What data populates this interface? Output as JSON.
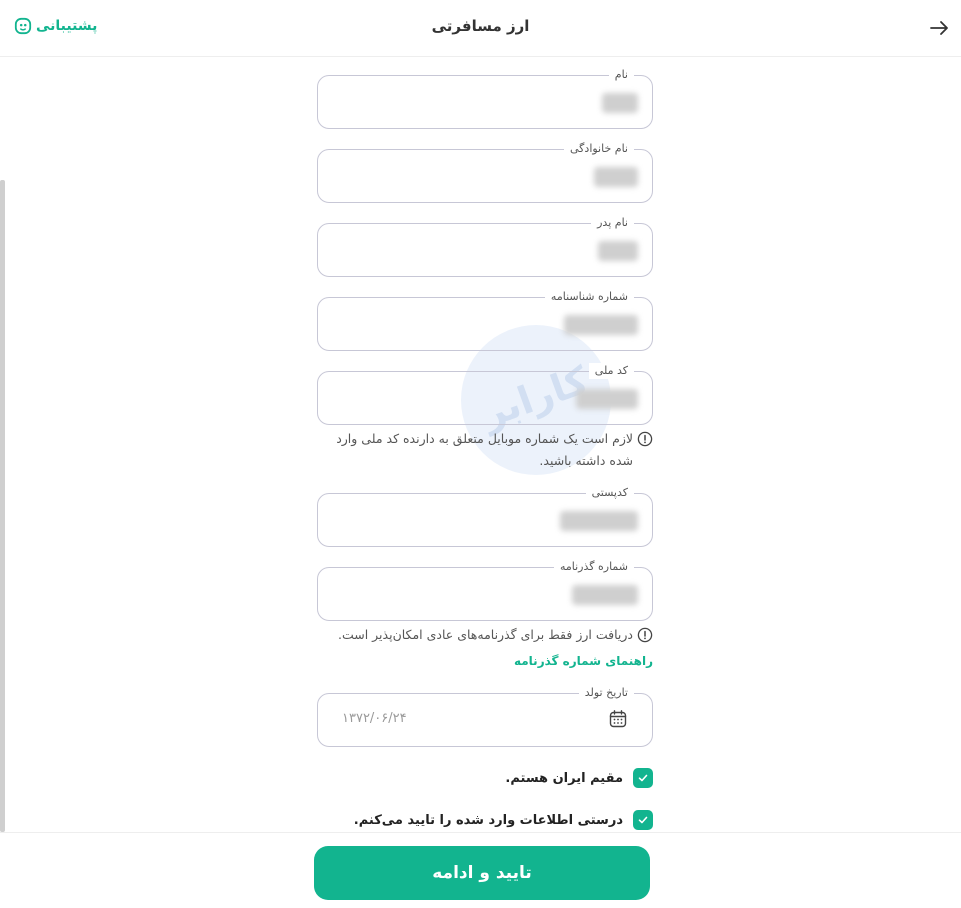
{
  "header": {
    "title": "ارز مسافرتی",
    "support_label": "پشتیبانی"
  },
  "form": {
    "fields": [
      {
        "label": "نام"
      },
      {
        "label": "نام خانوادگی"
      },
      {
        "label": "نام پدر"
      },
      {
        "label": "شماره شناسنامه"
      },
      {
        "label": "کد ملی"
      },
      {
        "label": "کدپستی"
      },
      {
        "label": "شماره گذرنامه"
      }
    ],
    "national_id_hint": "لازم است یک شماره موبایل متعلق به دارنده کد ملی وارد شده داشته باشید.",
    "passport_hint": "دریافت ارز فقط برای گذرنامه‌های عادی امکان‌پذیر است.",
    "passport_guide_link": "راهنمای شماره گذرنامه",
    "birth_date": {
      "label": "تاریخ تولد",
      "value": "۱۳۷۲/۰۶/۲۴"
    },
    "checkboxes": [
      {
        "label": "مقیم ایران هستم.",
        "checked": true
      },
      {
        "label": "درستی اطلاعات وارد شده را تایید می‌کنم.",
        "checked": true
      }
    ]
  },
  "footer": {
    "submit_label": "تایید و ادامه"
  },
  "colors": {
    "accent": "#12b48f",
    "border": "#c7c7d6"
  }
}
